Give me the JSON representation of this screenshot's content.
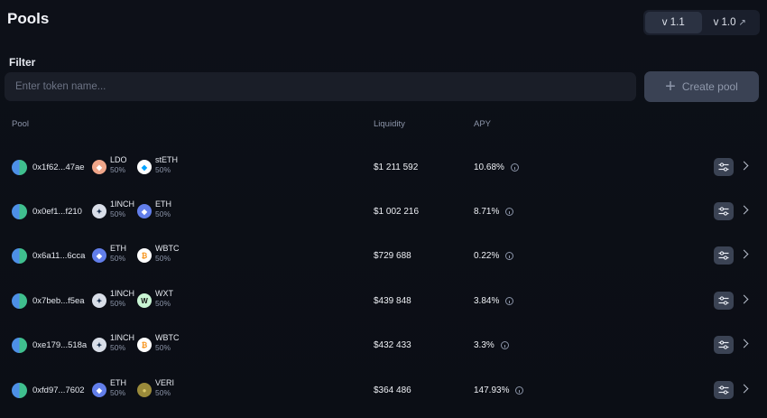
{
  "header": {
    "title": "Pools"
  },
  "versions": [
    {
      "label": "v 1.1",
      "active": true,
      "external": false
    },
    {
      "label": "v 1.0",
      "active": false,
      "external": true,
      "ext_glyph": "↗"
    }
  ],
  "filter": {
    "label": "Filter",
    "placeholder": "Enter token name..."
  },
  "create_button": {
    "icon": "plus-icon",
    "glyph": "+",
    "label": "Create pool"
  },
  "table": {
    "columns": {
      "pool": "Pool",
      "liquidity": "Liquidity",
      "apy": "APY"
    },
    "rows": [
      {
        "address": "0x1f62...47ae",
        "tokens": [
          {
            "symbol": "LDO",
            "weight": "50%",
            "icon": "ldo-icon",
            "glyph": "◆",
            "bg": "#f0a68a",
            "fg": "#ffffff"
          },
          {
            "symbol": "stETH",
            "weight": "50%",
            "icon": "steth-icon",
            "glyph": "◆",
            "bg": "#ffffff",
            "fg": "#00a3ff"
          }
        ],
        "liquidity": "$1 211 592",
        "apy": "10.68%"
      },
      {
        "address": "0x0ef1...f210",
        "tokens": [
          {
            "symbol": "1INCH",
            "weight": "50%",
            "icon": "1inch-icon",
            "glyph": "✦",
            "bg": "#d9dee8",
            "fg": "#1b314f"
          },
          {
            "symbol": "ETH",
            "weight": "50%",
            "icon": "eth-icon",
            "glyph": "◆",
            "bg": "#627eea",
            "fg": "#ffffff"
          }
        ],
        "liquidity": "$1 002 216",
        "apy": "8.71%"
      },
      {
        "address": "0x6a11...6cca",
        "tokens": [
          {
            "symbol": "ETH",
            "weight": "50%",
            "icon": "eth-icon",
            "glyph": "◆",
            "bg": "#627eea",
            "fg": "#ffffff"
          },
          {
            "symbol": "WBTC",
            "weight": "50%",
            "icon": "wbtc-icon",
            "glyph": "₿",
            "bg": "#ffffff",
            "fg": "#f7931a"
          }
        ],
        "liquidity": "$729 688",
        "apy": "0.22%"
      },
      {
        "address": "0x7beb...f5ea",
        "tokens": [
          {
            "symbol": "1INCH",
            "weight": "50%",
            "icon": "1inch-icon",
            "glyph": "✦",
            "bg": "#d9dee8",
            "fg": "#1b314f"
          },
          {
            "symbol": "WXT",
            "weight": "50%",
            "icon": "wxt-icon",
            "glyph": "W",
            "bg": "#c9f5d4",
            "fg": "#111111"
          }
        ],
        "liquidity": "$439 848",
        "apy": "3.84%"
      },
      {
        "address": "0xe179...518a",
        "tokens": [
          {
            "symbol": "1INCH",
            "weight": "50%",
            "icon": "1inch-icon",
            "glyph": "✦",
            "bg": "#d9dee8",
            "fg": "#1b314f"
          },
          {
            "symbol": "WBTC",
            "weight": "50%",
            "icon": "wbtc-icon",
            "glyph": "₿",
            "bg": "#ffffff",
            "fg": "#f7931a"
          }
        ],
        "liquidity": "$432 433",
        "apy": "3.3%"
      },
      {
        "address": "0xfd97...7602",
        "tokens": [
          {
            "symbol": "ETH",
            "weight": "50%",
            "icon": "eth-icon",
            "glyph": "◆",
            "bg": "#627eea",
            "fg": "#ffffff"
          },
          {
            "symbol": "VERI",
            "weight": "50%",
            "icon": "veri-icon",
            "glyph": "●",
            "bg": "#9a8a3a",
            "fg": "#d9c86a"
          }
        ],
        "liquidity": "$364 486",
        "apy": "147.93%"
      }
    ]
  }
}
